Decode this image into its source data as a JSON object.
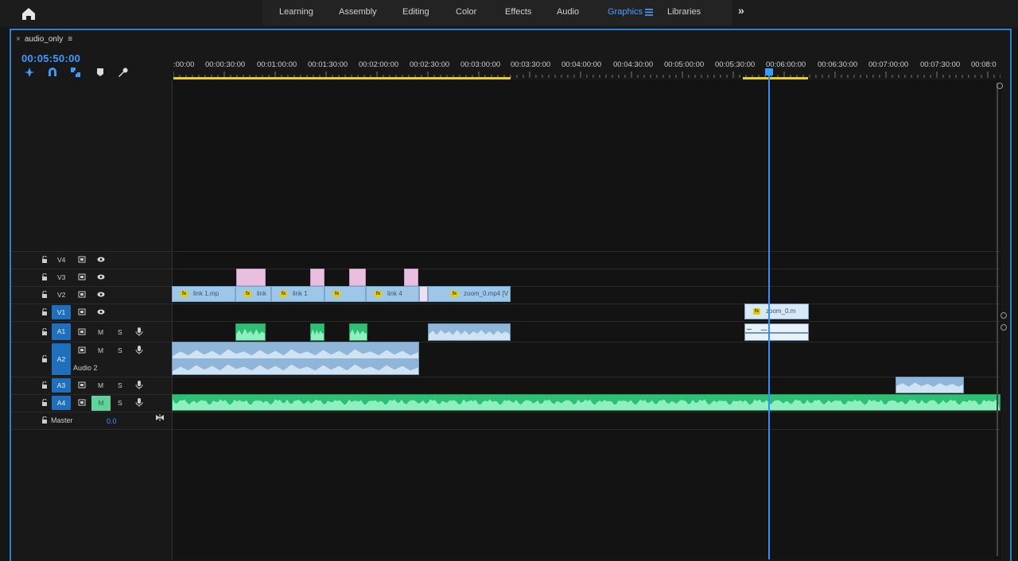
{
  "workspaces": {
    "tabs": [
      {
        "label": "Learning"
      },
      {
        "label": "Assembly"
      },
      {
        "label": "Editing"
      },
      {
        "label": "Color"
      },
      {
        "label": "Effects"
      },
      {
        "label": "Audio"
      },
      {
        "label": "Graphics",
        "active": true
      },
      {
        "label": "Libraries"
      }
    ],
    "menu_icon": "hamburger-icon",
    "overflow_icon": "double-chevron-right-icon"
  },
  "sequence": {
    "name": "audio_only",
    "timecode": "00:05:50:00"
  },
  "ruler": {
    "labels": [
      ":00:00",
      "00:00:30:00",
      "00:01:00:00",
      "00:01:30:00",
      "00:02:00:00",
      "00:02:30:00",
      "00:03:00:00",
      "00:03:30:00",
      "00:04:00:00",
      "00:04:30:00",
      "00:05:00:00",
      "00:05:30:00",
      "00:06:00:00",
      "00:06:30:00",
      "00:07:00:00",
      "00:07:30:00",
      "00:08:0"
    ]
  },
  "tracks": {
    "v4": "V4",
    "v3": "V3",
    "v2": "V2",
    "v1": "V1",
    "a1": "A1",
    "a2": "A2",
    "a2_name": "Audio 2",
    "a3": "A3",
    "a4": "A4",
    "mute": "M",
    "solo": "S",
    "master": "Master",
    "master_value": "0.0"
  },
  "clips": {
    "v2_1": "link 1.mp",
    "v2_2": "link",
    "v2_3": "link 1",
    "v2_4": "link 4",
    "v2_5": "zoom_0.mp4 [V",
    "v1_1": "zoom_0.m",
    "fx": "fx"
  },
  "colors": {
    "accent": "#2e8fff",
    "video_clip": "#9ec6e6",
    "audio_clip": "#8fb6d8",
    "green_clip": "#2fbf74",
    "pink_clip": "#e9bfe0",
    "work_area": "#e6d21a"
  }
}
